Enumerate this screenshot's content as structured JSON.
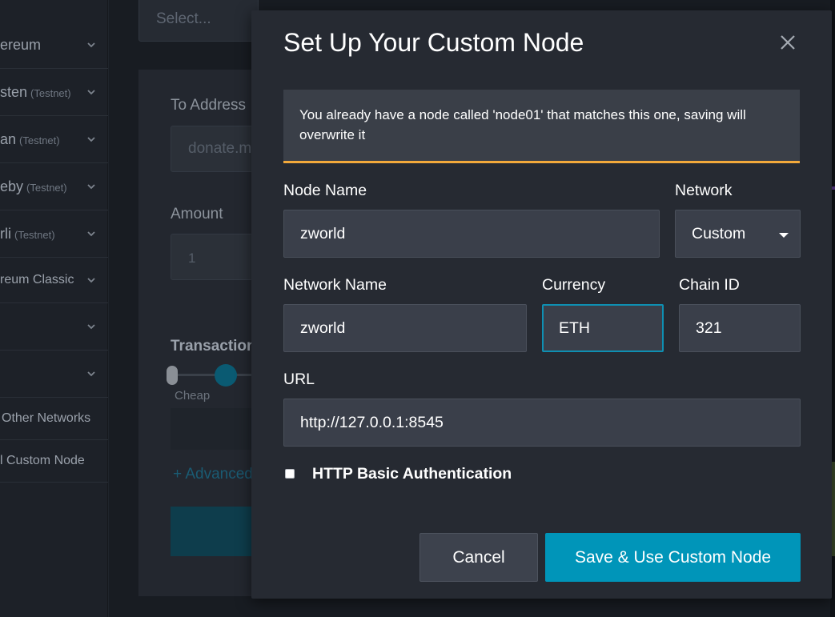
{
  "sidebar": {
    "items": [
      {
        "label": "ereum",
        "testnet": ""
      },
      {
        "label": "sten",
        "testnet": "(Testnet)"
      },
      {
        "label": "an",
        "testnet": "(Testnet)"
      },
      {
        "label": "eby",
        "testnet": "(Testnet)"
      },
      {
        "label": "rli",
        "testnet": "(Testnet)"
      },
      {
        "label": "reum Classic",
        "testnet": ""
      },
      {
        "label": "",
        "testnet": ""
      },
      {
        "label": "",
        "testnet": ""
      }
    ],
    "other_networks": "Other Networks",
    "custom_node": "l Custom Node"
  },
  "background": {
    "select_placeholder": "Select...",
    "to_address_label": "To Address",
    "to_address_placeholder": "donate.m",
    "amount_label": "Amount",
    "amount_placeholder": "1",
    "transaction_label": "Transaction",
    "cheap_label": "Cheap",
    "advanced_link": "+ Advanced"
  },
  "modal": {
    "title": "Set Up Your Custom Node",
    "warning": "You already have a node called 'node01' that matches this one, saving will overwrite it",
    "warning_color": "#f2a93b",
    "node_name_label": "Node Name",
    "node_name_value": "zworld",
    "network_label": "Network",
    "network_value": "Custom",
    "network_name_label": "Network Name",
    "network_name_value": "zworld",
    "currency_label": "Currency",
    "currency_value": "ETH",
    "chain_id_label": "Chain ID",
    "chain_id_value": "321",
    "url_label": "URL",
    "url_value": "http://127.0.0.1:8545",
    "http_auth_label": "HTTP Basic Authentication",
    "http_auth_checked": false,
    "cancel_button": "Cancel",
    "save_button": "Save & Use Custom Node",
    "accent_color": "#0095b9"
  }
}
